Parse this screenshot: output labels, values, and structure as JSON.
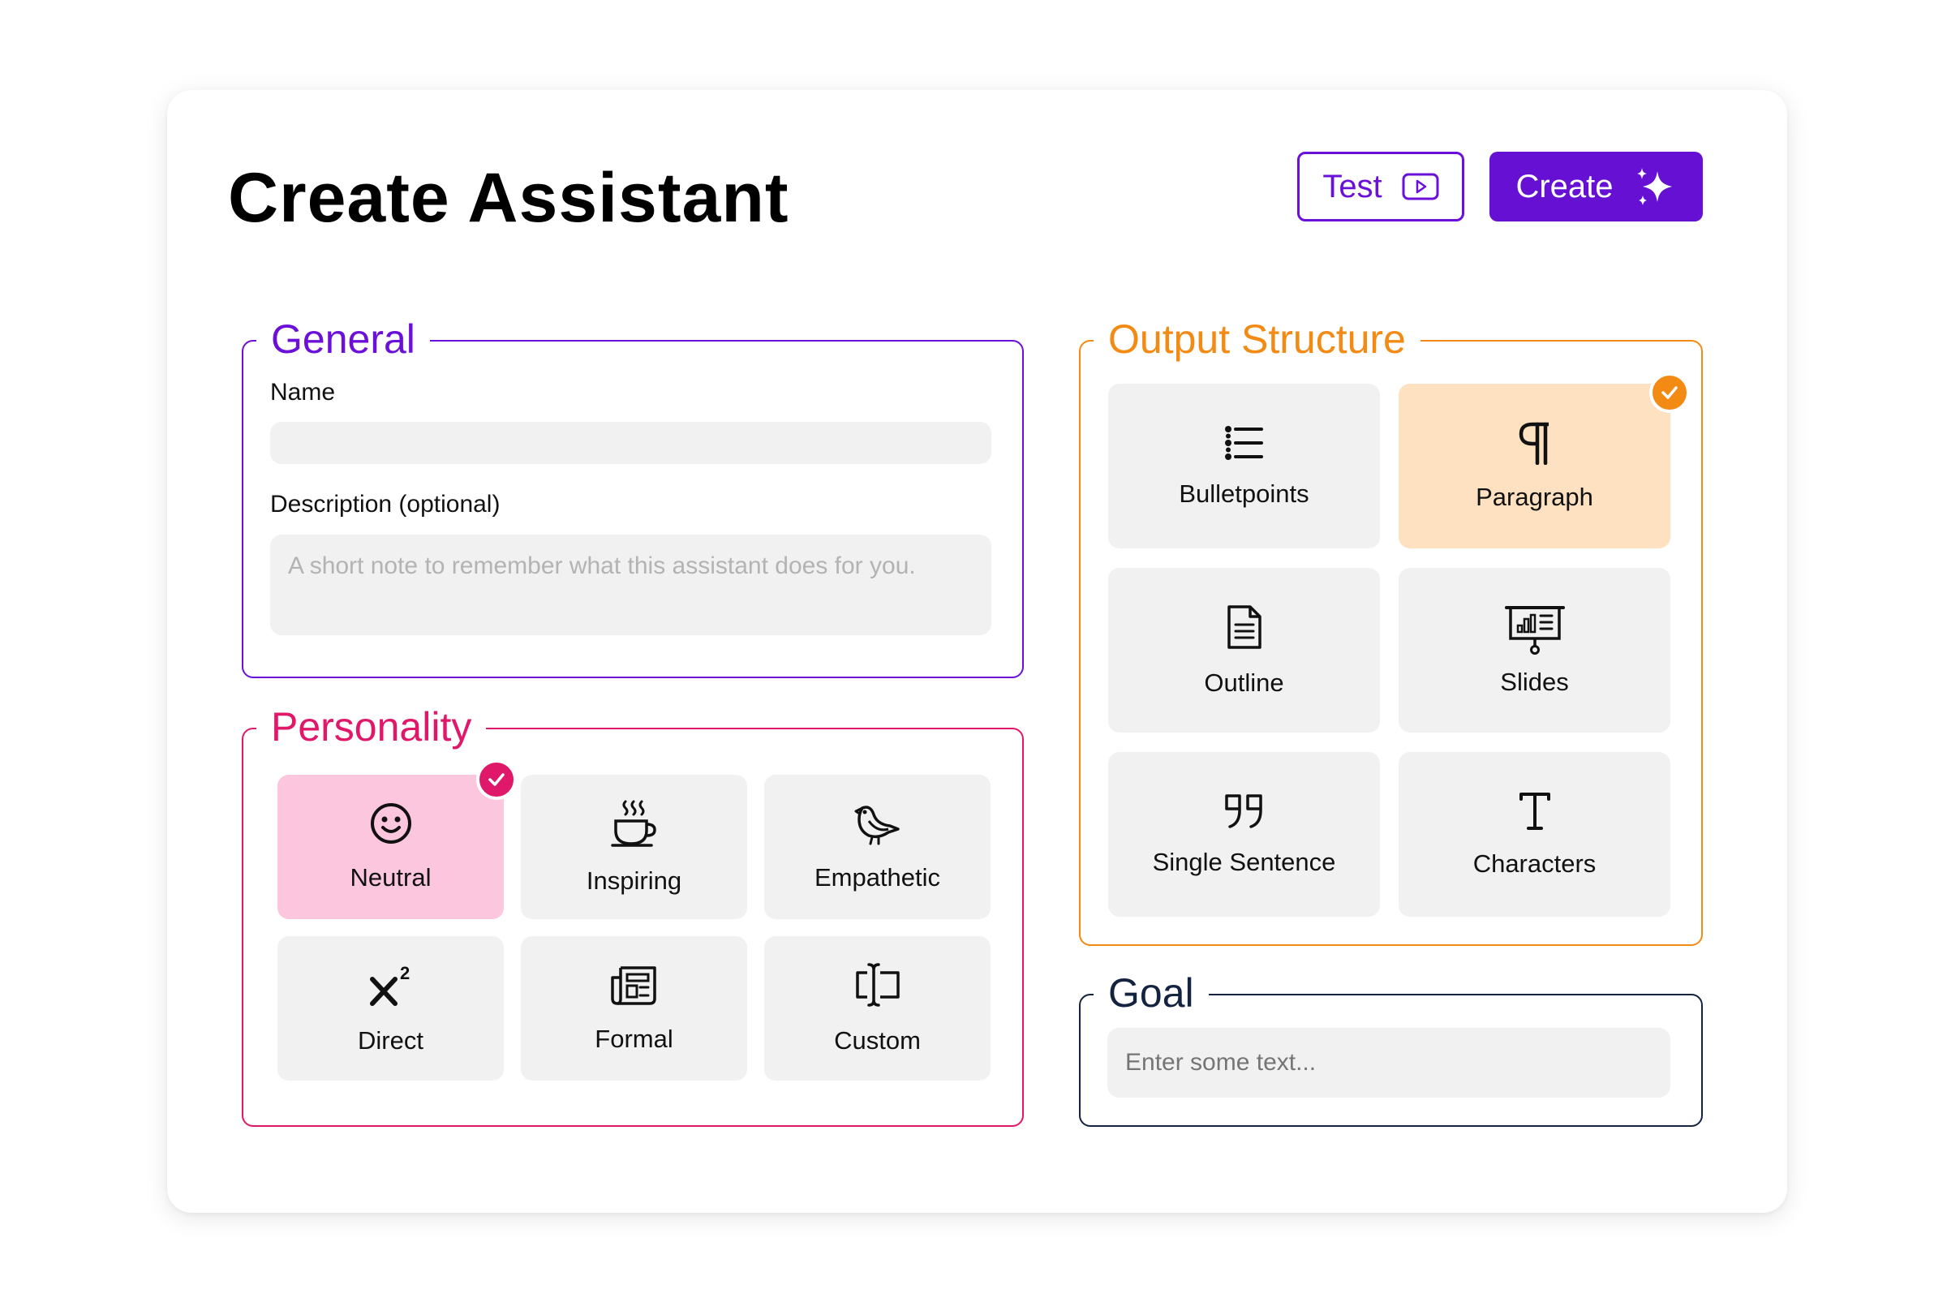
{
  "header": {
    "title": "Create Assistant",
    "test_label": "Test",
    "create_label": "Create"
  },
  "general": {
    "legend": "General",
    "name_label": "Name",
    "name_value": "",
    "description_label": "Description (optional)",
    "description_placeholder": "A short note to remember what this assistant does for you."
  },
  "personality": {
    "legend": "Personality",
    "selected": "Neutral",
    "options": [
      {
        "label": "Neutral",
        "icon": "smiley-icon"
      },
      {
        "label": "Inspiring",
        "icon": "coffee-cup-icon"
      },
      {
        "label": "Empathetic",
        "icon": "bird-icon"
      },
      {
        "label": "Direct",
        "icon": "superscript-icon"
      },
      {
        "label": "Formal",
        "icon": "newspaper-icon"
      },
      {
        "label": "Custom",
        "icon": "text-cursor-box-icon"
      }
    ]
  },
  "output": {
    "legend": "Output Structure",
    "selected": "Paragraph",
    "options": [
      {
        "label": "Bulletpoints",
        "icon": "list-icon"
      },
      {
        "label": "Paragraph",
        "icon": "pilcrow-icon"
      },
      {
        "label": "Outline",
        "icon": "document-icon"
      },
      {
        "label": "Slides",
        "icon": "presentation-icon"
      },
      {
        "label": "Single Sentence",
        "icon": "quote-icon"
      },
      {
        "label": "Characters",
        "icon": "text-t-icon"
      }
    ]
  },
  "goal": {
    "legend": "Goal",
    "placeholder": "Enter some text..."
  },
  "colors": {
    "purple": "#6b10d9",
    "pink": "#e0186a",
    "orange": "#f28a14",
    "navy": "#14233f",
    "pink_selected_bg": "#fcc6de",
    "orange_selected_bg": "#fde1c1",
    "tile_bg": "#f1f1f1"
  }
}
